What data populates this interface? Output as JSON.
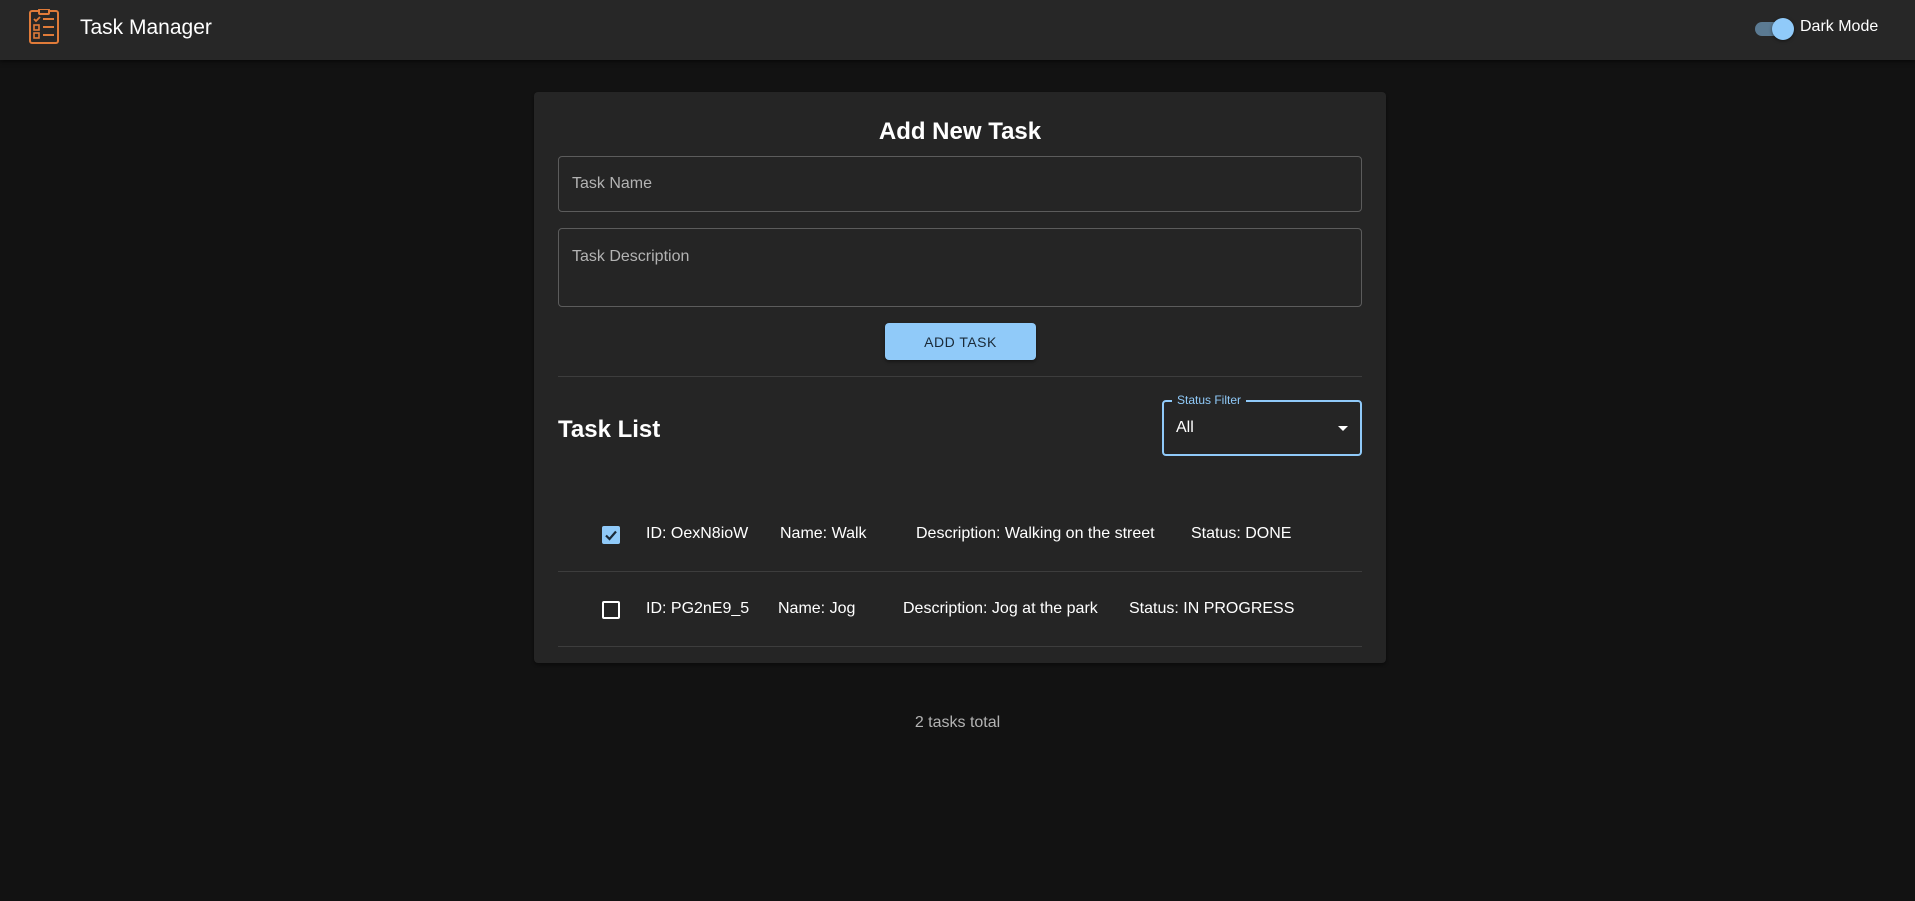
{
  "app": {
    "title": "Task Manager",
    "logo_icon": "task-list-icon",
    "dark_mode_label": "Dark Mode",
    "dark_mode_on": true
  },
  "form": {
    "title": "Add New Task",
    "task_name_placeholder": "Task Name",
    "task_description_placeholder": "Task Description",
    "add_button_label": "ADD TASK"
  },
  "list": {
    "title": "Task List",
    "filter_label": "Status Filter",
    "filter_value": "All",
    "tasks": [
      {
        "checked": true,
        "id": "ID: OexN8ioW",
        "name": "Name: Walk",
        "description": "Description: Walking on the street",
        "status": "Status: DONE"
      },
      {
        "checked": false,
        "id": "ID: PG2nE9_5",
        "name": "Name: Jog",
        "description": "Description: Jog at the park",
        "status": "Status: IN PROGRESS"
      }
    ]
  },
  "footer": {
    "count_text": "2 tasks total"
  },
  "colors": {
    "accent": "#90caf9",
    "background": "#121212",
    "surface": "#252525",
    "appbar": "#272727",
    "logo": "#e07b39"
  }
}
